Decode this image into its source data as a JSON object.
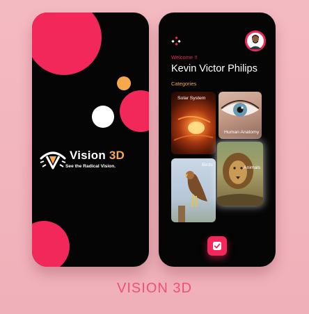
{
  "splash_screen": {
    "logo_word_main": "Vision",
    "logo_word_accent": "3D",
    "tagline": "See the Radical Vision."
  },
  "home_screen": {
    "app_icon": "app-dots-icon",
    "avatar": "user-avatar",
    "welcome": "Welcome !!",
    "user_name": "Kevin Victor Philips",
    "categories_title": "Categories",
    "categories": [
      {
        "label": "Solar System"
      },
      {
        "label": "Human Anatomy"
      },
      {
        "label": "Birds"
      },
      {
        "label": "Animals"
      }
    ],
    "confirm_icon": "check-icon"
  },
  "caption": "VISION 3D",
  "colors": {
    "accent_red": "#f2285a",
    "accent_orange": "#f6a94b",
    "phone_bg": "#050505",
    "page_bg": "#f2b5bd",
    "caption": "#ef4f7a"
  }
}
